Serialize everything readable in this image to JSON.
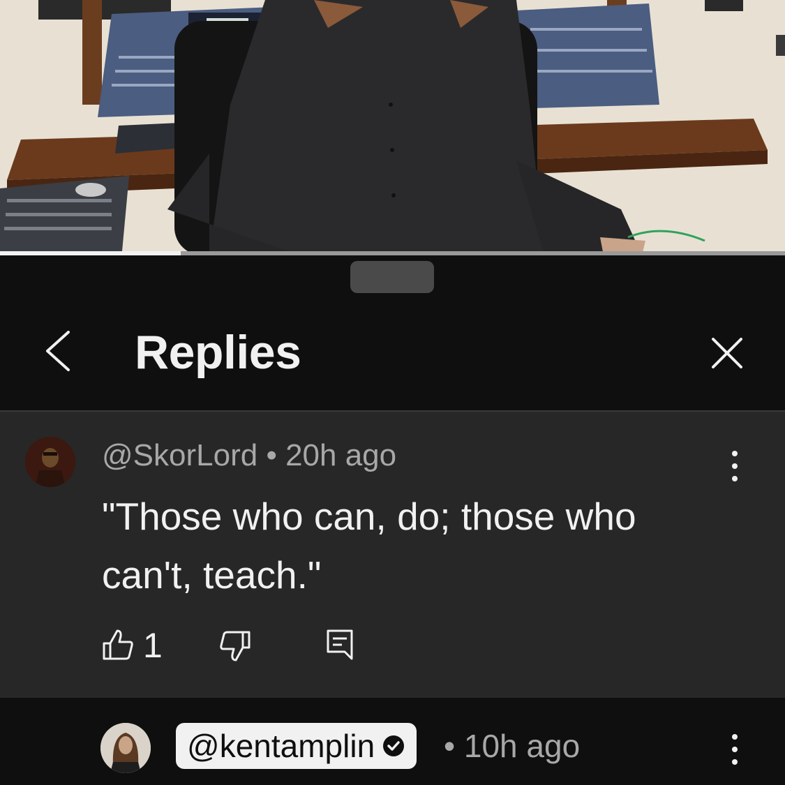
{
  "video": {
    "progress_fraction": 0.23,
    "description_icon": "studio-mixing-desk-scene"
  },
  "sheet": {
    "title": "Replies",
    "back_icon": "chevron-left-icon",
    "close_icon": "close-icon"
  },
  "parent_comment": {
    "author": "@SkorLord",
    "separator": "•",
    "time": "20h ago",
    "text": "\"Those who can, do; those who can't, teach.\"",
    "like_count": "1",
    "icons": [
      "thumbs-up-icon",
      "thumbs-down-icon",
      "reply-icon",
      "more-vert-icon"
    ]
  },
  "reply_comment": {
    "author": "@kentamplin",
    "verified_icon": "verified-check-icon",
    "separator": "•",
    "time": "10h ago"
  },
  "colors": {
    "background": "#0f0f0f",
    "parent_highlight": "#272727",
    "text_primary": "#f1f1f1",
    "text_secondary": "#a8a8a8"
  }
}
